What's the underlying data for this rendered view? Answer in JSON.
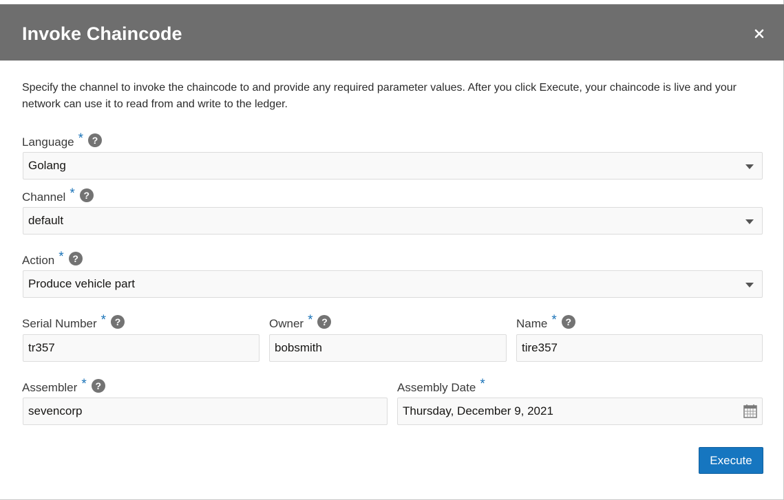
{
  "dialog": {
    "title": "Invoke Chaincode",
    "close_icon": "close-icon",
    "description": "Specify the channel to invoke the chaincode to and provide any required parameter values. After you click Execute, your chaincode is live and your network can use it to read from and write to the ledger."
  },
  "form": {
    "required_marker": "*",
    "help_glyph": "?",
    "language": {
      "label": "Language",
      "value": "Golang"
    },
    "channel": {
      "label": "Channel",
      "value": "default"
    },
    "action": {
      "label": "Action",
      "value": "Produce vehicle part"
    },
    "serial_number": {
      "label": "Serial Number",
      "value": "tr357"
    },
    "owner": {
      "label": "Owner",
      "value": "bobsmith"
    },
    "name": {
      "label": "Name",
      "value": "tire357"
    },
    "assembler": {
      "label": "Assembler",
      "value": "sevencorp"
    },
    "assembly_date": {
      "label": "Assembly Date",
      "value": "Thursday, December 9, 2021",
      "icon": "calendar-icon"
    }
  },
  "actions": {
    "execute_label": "Execute"
  },
  "colors": {
    "header": "#6e6e6e",
    "accent": "#1676c0",
    "required": "#1a73b8"
  }
}
